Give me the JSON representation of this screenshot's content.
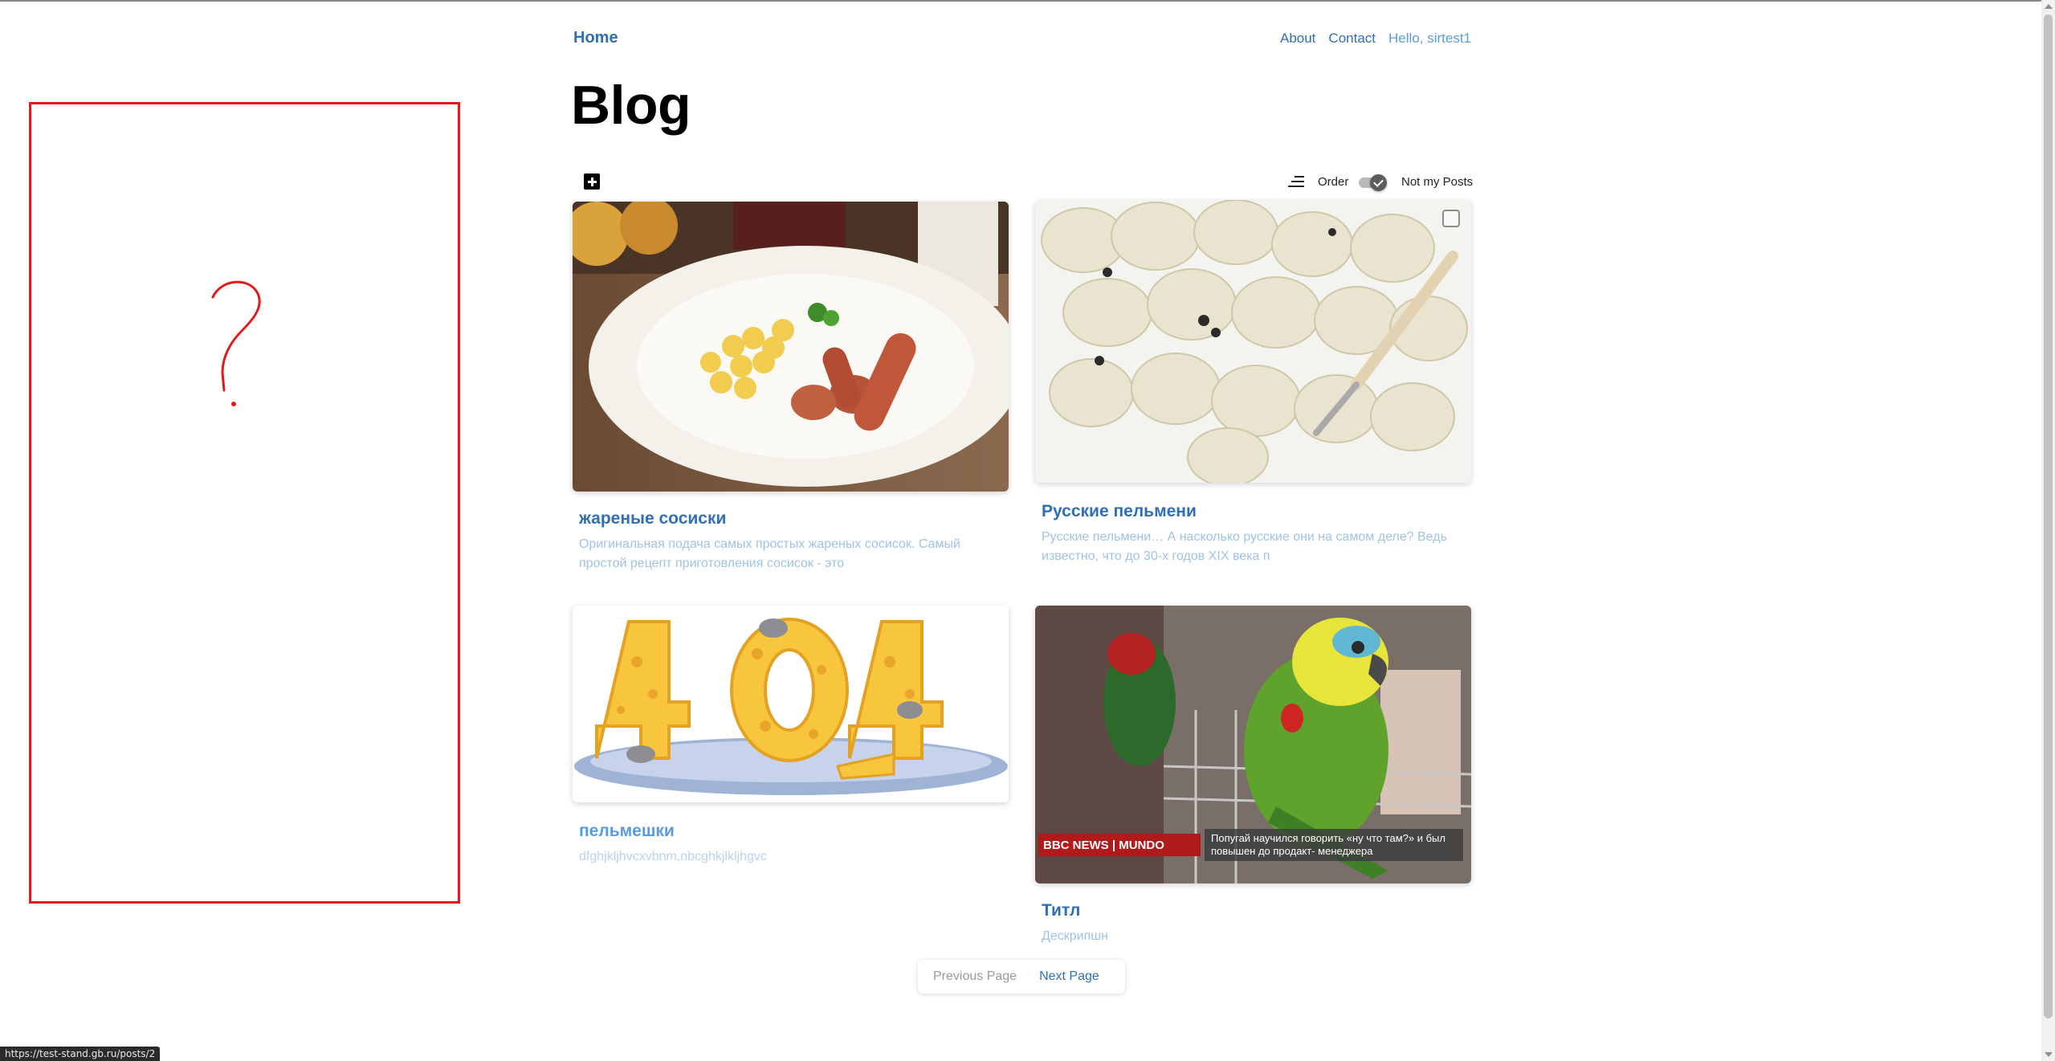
{
  "nav": {
    "home": "Home",
    "about": "About",
    "contact": "Contact",
    "greeting": "Hello, sirtest1"
  },
  "page": {
    "title": "Blog"
  },
  "toolbar": {
    "add_icon": "plus-square-icon",
    "sort_icon": "sort-icon",
    "order_label": "Order",
    "not_my_posts_label": "Not my Posts",
    "not_my_posts_checked": true
  },
  "sketch": {
    "drawing": "question-mark",
    "color": "#e21a1a"
  },
  "posts": [
    {
      "title": "жареные сосиски",
      "description": "Оригинальная подача самых простых жареных сосисок. Самый простой рецепт приготовления сосисок - это",
      "image": "fried-sausages-photo"
    },
    {
      "title": "Русские пельмени",
      "description": "Русские пельмени… А насколько русские они на самом деле? Ведь известно, что до 30-х годов XIX века п",
      "image": "dumplings-photo"
    },
    {
      "title": "пельмешки",
      "description": "dfghjkljhvcxvbnm,nbcghkjlkljhgvc",
      "image": "404-cheese-illustration"
    },
    {
      "title": "Титл",
      "description": "Дескрипшн",
      "image": "parrot-photo",
      "overlay_brand": "BBC NEWS | MUNDO",
      "overlay_caption": "Попугай научился говорить «ну что там?» и был повышен до  продакт- менеджера"
    }
  ],
  "pagination": {
    "previous": "Previous Page",
    "next": "Next Page"
  },
  "status_bar": {
    "url": "https://test-stand.gb.ru/posts/2"
  },
  "colors": {
    "link": "#2f6fb6",
    "muted_link": "#5a9bdc",
    "description": "#9ec2e6"
  }
}
